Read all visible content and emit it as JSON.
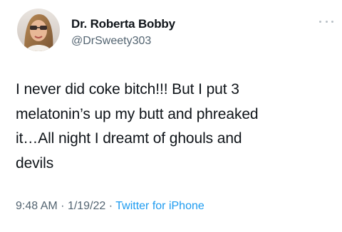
{
  "tweet": {
    "author": {
      "name": "Dr. Roberta Bobby",
      "handle": "@DrSweety303"
    },
    "text": "I never did coke bitch!!! But I put 3\nmelatonin’s up my butt and phreaked\nit…All night I dreamt of ghouls and\ndevils",
    "time": "9:48 AM",
    "date": "1/19/22",
    "separator": "·",
    "source": "Twitter for iPhone"
  }
}
